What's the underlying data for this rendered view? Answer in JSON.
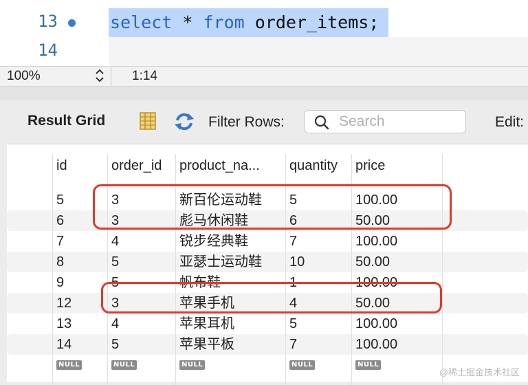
{
  "editor": {
    "lines": [
      {
        "number": "13",
        "has_marker": true
      },
      {
        "number": "14",
        "has_marker": false
      }
    ],
    "code_tokens": [
      {
        "text": "select",
        "kind": "keyword"
      },
      {
        "text": " * ",
        "kind": "plain"
      },
      {
        "text": "from",
        "kind": "keyword"
      },
      {
        "text": " order_items;",
        "kind": "plain"
      }
    ]
  },
  "status": {
    "zoom": "100%",
    "cursor": "1:14"
  },
  "toolbar": {
    "result_grid_label": "Result Grid",
    "filter_label": "Filter Rows:",
    "search_placeholder": "Search",
    "edit_label": "Edit:",
    "icons": [
      "grid-form-icon",
      "refresh-icon",
      "search-icon"
    ]
  },
  "grid": {
    "columns": [
      "id",
      "order_id",
      "product_na...",
      "quantity",
      "price"
    ],
    "rows": [
      [
        "5",
        "3",
        "新百伦运动鞋",
        "5",
        "100.00"
      ],
      [
        "6",
        "3",
        "彪马休闲鞋",
        "6",
        "50.00"
      ],
      [
        "7",
        "4",
        "锐步经典鞋",
        "7",
        "100.00"
      ],
      [
        "8",
        "5",
        "亚瑟士运动鞋",
        "10",
        "50.00"
      ],
      [
        "9",
        "5",
        "帆布鞋",
        "1",
        "100.00"
      ],
      [
        "12",
        "3",
        "苹果手机",
        "4",
        "50.00"
      ],
      [
        "13",
        "4",
        "苹果耳机",
        "5",
        "100.00"
      ],
      [
        "14",
        "5",
        "苹果平板",
        "7",
        "100.00"
      ]
    ],
    "null_label": "NULL"
  },
  "watermark": "@稀土掘金技术社区",
  "colors": {
    "keyword": "#2a63c9",
    "selection": "#bcd7fb",
    "highlight": "#e0392b",
    "line_number": "#3a6fa5"
  }
}
